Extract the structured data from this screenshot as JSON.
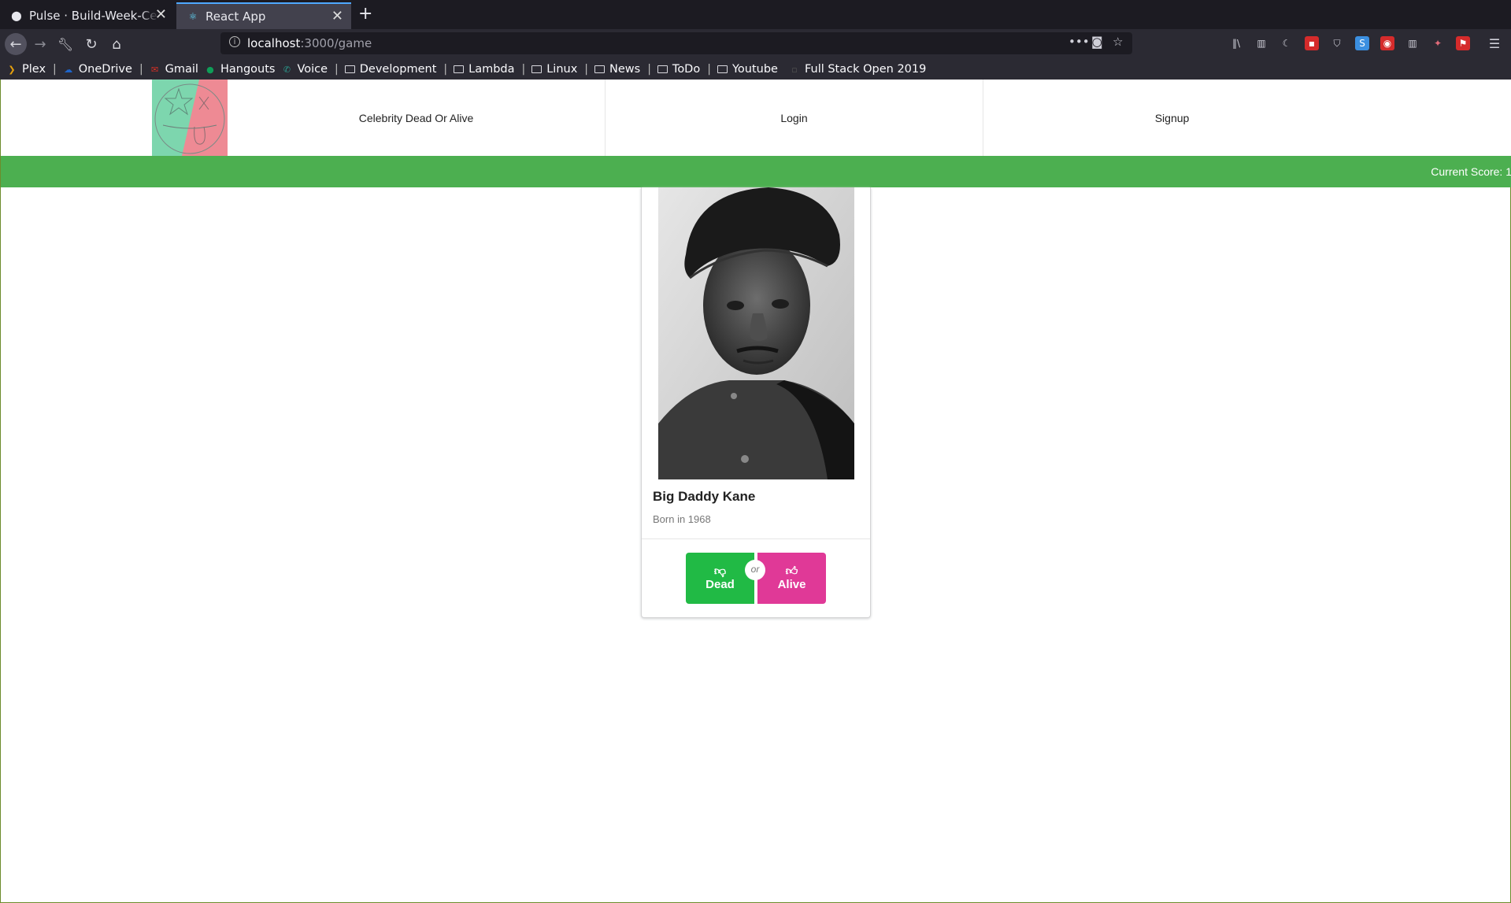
{
  "browser": {
    "tabs": [
      {
        "title": "Pulse · Build-Week-Celebrity",
        "active": false
      },
      {
        "title": "React App",
        "active": true
      }
    ],
    "url_host": "localhost",
    "url_path": ":3000/game",
    "bookmarks": [
      {
        "label": "Plex",
        "icon": "plex-icon"
      },
      {
        "label": "OneDrive",
        "icon": "onedrive-icon"
      },
      {
        "label": "Gmail",
        "icon": "gmail-icon"
      },
      {
        "label": "Hangouts",
        "icon": "hangouts-icon"
      },
      {
        "label": "Voice",
        "icon": "voice-icon"
      },
      {
        "label": "Development",
        "icon": "folder-icon"
      },
      {
        "label": "Lambda",
        "icon": "folder-icon"
      },
      {
        "label": "Linux",
        "icon": "folder-icon"
      },
      {
        "label": "News",
        "icon": "folder-icon"
      },
      {
        "label": "ToDo",
        "icon": "folder-icon"
      },
      {
        "label": "Youtube",
        "icon": "folder-icon"
      },
      {
        "label": "Full Stack Open 2019",
        "icon": "bookmark-icon"
      }
    ]
  },
  "header": {
    "nav": [
      "Celebrity Dead Or Alive",
      "Login",
      "Signup"
    ]
  },
  "score": {
    "label": "Current Score: 1"
  },
  "card": {
    "name": "Big Daddy Kane",
    "born": "Born in 1968",
    "dead_label": "Dead",
    "alive_label": "Alive",
    "or_label": "or"
  },
  "colors": {
    "score_bar": "#4caf50",
    "dead_button": "#21ba45",
    "alive_button": "#e03997",
    "logo_green": "#7dd6ae",
    "logo_pink": "#ee8a94"
  }
}
